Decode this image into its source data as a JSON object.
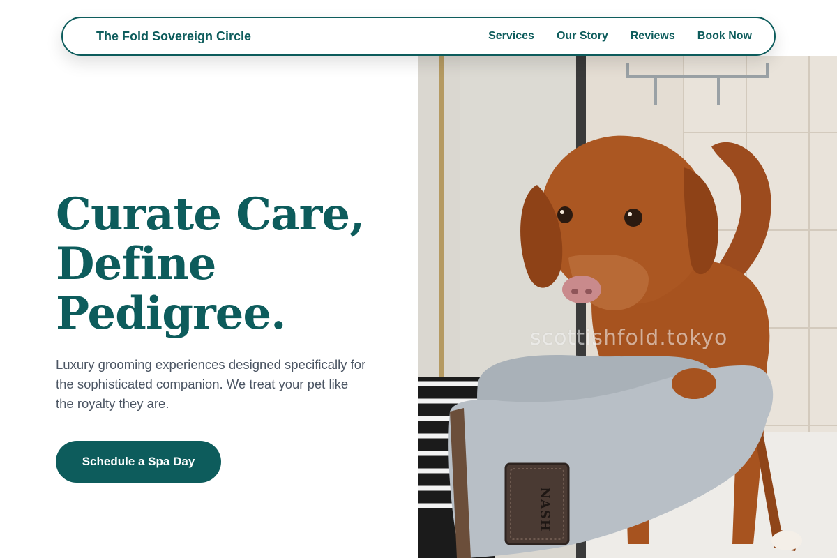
{
  "navbar": {
    "brand": "The Fold Sovereign Circle",
    "links": [
      "Services",
      "Our Story",
      "Reviews",
      "Book Now"
    ]
  },
  "hero": {
    "headline_lines": [
      "Curate Care,",
      "Define",
      "Pedigree."
    ],
    "subtext": "Luxury grooming experiences designed specifically for the sophisticated companion. We treat your pet like the royalty they are.",
    "cta_label": "Schedule a Spa Day",
    "watermark": "scottishfold.tokyo",
    "glove_brand": "NASH"
  },
  "colors": {
    "brand_teal": "#0d5c5c",
    "body_text": "#4b5563",
    "background": "#ffffff"
  },
  "icons": {
    "photo": "wet-dog-bath-photo"
  }
}
